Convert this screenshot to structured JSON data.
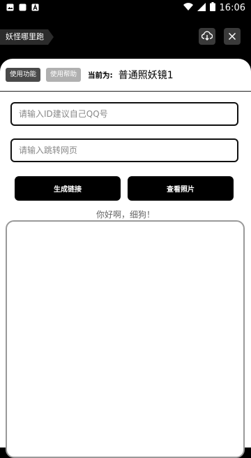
{
  "status_bar": {
    "time": "16:06",
    "icons_left": [
      "image-icon",
      "square-icon",
      "a-icon"
    ],
    "icons_right": [
      "wifi-icon",
      "signal-icon",
      "battery-icon"
    ]
  },
  "header": {
    "title": "妖怪哪里跑",
    "icons": [
      "cloud-download-icon",
      "close-icon"
    ]
  },
  "toolbar": {
    "use_function": "使用功能",
    "use_help": "使用帮助",
    "current_label": "当前为:",
    "current_value": "普通照妖镜1"
  },
  "form": {
    "id_placeholder": "请输入ID建议自己QQ号",
    "url_placeholder": "请输入跳转网页"
  },
  "actions": {
    "generate": "生成链接",
    "view_photos": "查看照片"
  },
  "greeting": "你好啊，细狗！",
  "colors": {
    "background": "#000000",
    "panel": "#ffffff",
    "button": "#000000"
  }
}
